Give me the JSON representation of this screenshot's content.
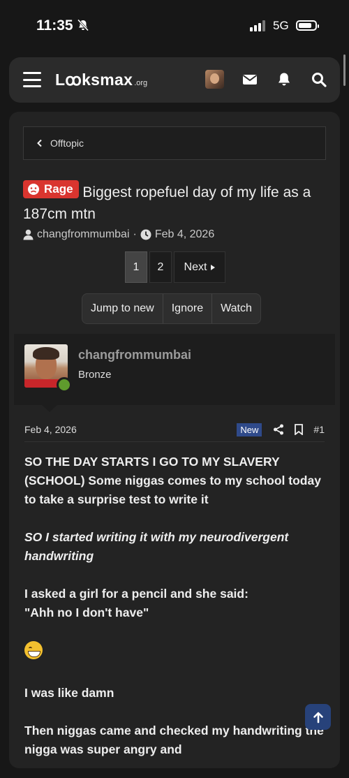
{
  "status_bar": {
    "time": "11:35",
    "network": "5G"
  },
  "nav": {
    "logo_main": "Lꝏksmax",
    "logo_tld": ".org"
  },
  "breadcrumb": {
    "label": "Offtopic"
  },
  "thread": {
    "prefix": "Rage",
    "title": "Biggest ropefuel day of my life as a 187cm mtn",
    "author": "changfrommumbai",
    "separator": "·",
    "date": "Feb 4, 2026"
  },
  "pagination": {
    "pages": [
      "1",
      "2"
    ],
    "next_label": "Next",
    "current": "1"
  },
  "actions": {
    "jump": "Jump to new",
    "ignore": "Ignore",
    "watch": "Watch"
  },
  "post": {
    "username": "changfrommumbai",
    "rank": "Bronze",
    "date": "Feb 4, 2026",
    "new_badge": "New",
    "number": "#1",
    "paragraphs": [
      "SO THE DAY STARTS I GO TO MY SLAVERY (SCHOOL) Some niggas comes to my school today to take a surprise test to write it",
      "SO I started writing it with my neurodivergent handwriting",
      "I asked a girl for a pencil and she said:",
      "\"Ahh no I don't have\"",
      "I was like damn",
      "Then niggas came and checked my handwriting the nigga was super angry and"
    ]
  },
  "colors": {
    "prefix_red": "#d9352f",
    "new_badge": "#2f4a8a",
    "online": "#5f9b2d",
    "to_top": "#27427a"
  }
}
